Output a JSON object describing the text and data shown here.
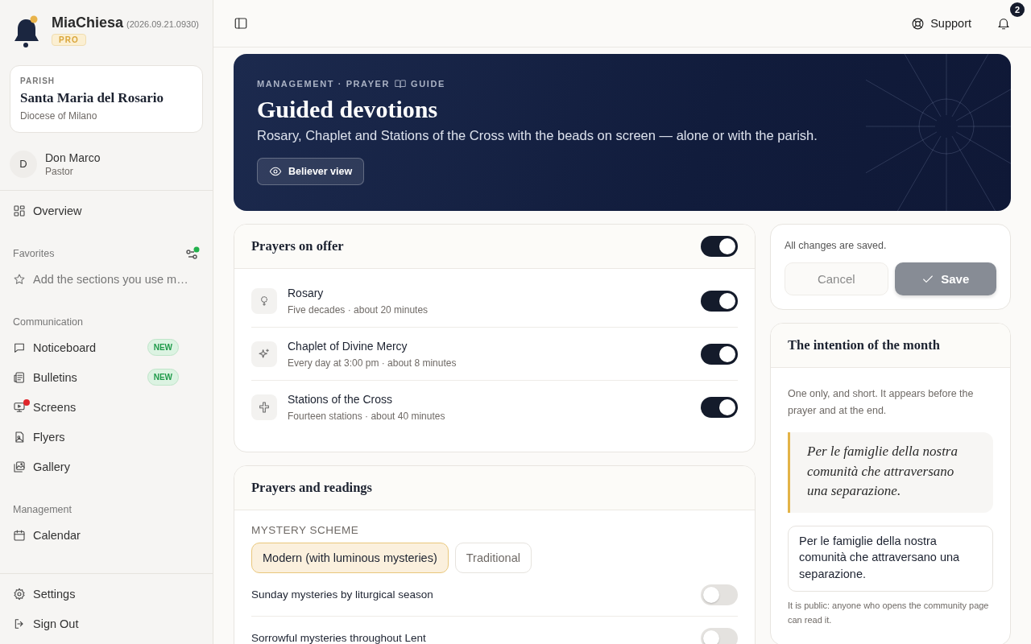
{
  "app": {
    "name": "MiaChiesa",
    "version": "(2026.09.21.0930)",
    "plan": "PRO"
  },
  "parish": {
    "label": "PARISH",
    "name": "Santa Maria del Rosario",
    "diocese": "Diocese of Milano"
  },
  "user": {
    "initial": "D",
    "name": "Don Marco",
    "role": "Pastor"
  },
  "sidebar": {
    "overview": {
      "label": "Overview",
      "selected": false
    },
    "favorites": {
      "title": "Favorites",
      "hint": "Add the sections you use m…"
    },
    "sections": [
      {
        "title": "Communication",
        "items": [
          {
            "label": "Noticeboard",
            "badge": "NEW",
            "alert": false,
            "selected": false
          },
          {
            "label": "Bulletins",
            "badge": "NEW",
            "alert": false,
            "selected": false
          },
          {
            "label": "Screens",
            "alert": true,
            "selected": false
          },
          {
            "label": "Flyers",
            "alert": false,
            "selected": false
          },
          {
            "label": "Gallery",
            "alert": false,
            "selected": false
          }
        ]
      },
      {
        "title": "Management",
        "items": [
          {
            "label": "Calendar",
            "alert": false,
            "selected": false
          }
        ]
      }
    ],
    "footer": [
      {
        "label": "Settings"
      },
      {
        "label": "Sign Out"
      }
    ]
  },
  "topbar": {
    "support": "Support",
    "notifications": "2"
  },
  "hero": {
    "breadcrumb": "MANAGEMENT · PRAYER",
    "section": "GUIDE",
    "title": "Guided devotions",
    "subtitle": "Rosary, Chaplet and Stations of the Cross with the beads on screen — alone or with the parish.",
    "button": "Believer view"
  },
  "prayers": {
    "title": "Prayers on offer",
    "on": true,
    "items": [
      {
        "name": "Rosary",
        "detail": "Five decades · about 20 minutes",
        "on": true
      },
      {
        "name": "Chaplet of Divine Mercy",
        "detail": "Every day at 3:00 pm · about 8 minutes",
        "on": true
      },
      {
        "name": "Stations of the Cross",
        "detail": "Fourteen stations · about 40 minutes",
        "on": true
      }
    ]
  },
  "readings": {
    "title": "Prayers and readings",
    "scheme_label": "MYSTERY SCHEME",
    "options": [
      {
        "label": "Modern (with luminous mysteries)",
        "selected": true
      },
      {
        "label": "Traditional",
        "selected": false
      }
    ],
    "settings": [
      {
        "label": "Sunday mysteries by liturgical season",
        "on": false
      },
      {
        "label": "Sorrowful mysteries throughout Lent",
        "on": false
      }
    ]
  },
  "save_panel": {
    "status": "All changes are saved.",
    "cancel": "Cancel",
    "save": "Save",
    "disabled": true
  },
  "intention": {
    "title": "The intention of the month",
    "hint": "One only, and short. It appears before the prayer and at the end.",
    "quote": "Per le famiglie della nostra comunità che attraversano una separazione.",
    "value": "Per le famiglie della nostra comunità che attraversano una separazione.",
    "note": "It is public: anyone who opens the community page can read it."
  }
}
